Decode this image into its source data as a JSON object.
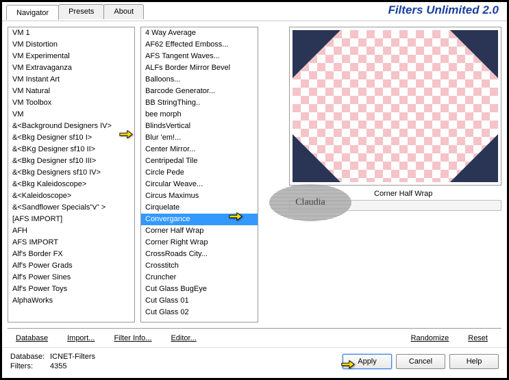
{
  "app_title": "Filters Unlimited 2.0",
  "tabs": [
    "Navigator",
    "Presets",
    "About"
  ],
  "list_categories": [
    "VM 1",
    "VM Distortion",
    "VM Experimental",
    "VM Extravaganza",
    "VM Instant Art",
    "VM Natural",
    "VM Toolbox",
    "VM",
    "&<Background Designers IV>",
    "&<Bkg Designer sf10 I>",
    "&<BKg Designer sf10 II>",
    "&<Bkg Designer sf10 III>",
    "&<Bkg Designers sf10 IV>",
    "&<Bkg Kaleidoscope>",
    "&<Kaleidoscope>",
    "&<Sandflower Specials\"v\" >",
    "[AFS IMPORT]",
    "AFH",
    "AFS IMPORT",
    "Alf's Border FX",
    "Alf's Power Grads",
    "Alf's Power Sines",
    "Alf's Power Toys",
    "AlphaWorks"
  ],
  "selected_filter_index": 16,
  "list_filters": [
    "4 Way Average",
    "AF62 Effected Emboss...",
    "AFS Tangent Waves...",
    "ALFs Border Mirror Bevel",
    "Balloons...",
    "Barcode Generator...",
    "BB StringThing..",
    "bee morph",
    "BlindsVertical",
    "Blur 'em!...",
    "Center Mirror...",
    "Centripedal Tile",
    "Circle Pede",
    "Circular Weave...",
    "Circus Maximus",
    "Cirquelate",
    "Convergance",
    "Corner Half Wrap",
    "Corner Right Wrap",
    "CrossRoads City...",
    "Crosstitch",
    "Cruncher",
    "Cut Glass  BugEye",
    "Cut Glass 01",
    "Cut Glass 02"
  ],
  "param_name": "Corner Half Wrap",
  "bottom_links": {
    "database": "Database",
    "import": "Import...",
    "filter_info": "Filter Info...",
    "editor": "Editor...",
    "randomize": "Randomize",
    "reset": "Reset"
  },
  "info": {
    "db_label": "Database:",
    "db_value": "ICNET-Filters",
    "filters_label": "Filters:",
    "filters_value": "4355"
  },
  "buttons": {
    "apply": "Apply",
    "cancel": "Cancel",
    "help": "Help"
  },
  "watermark": "Claudia"
}
